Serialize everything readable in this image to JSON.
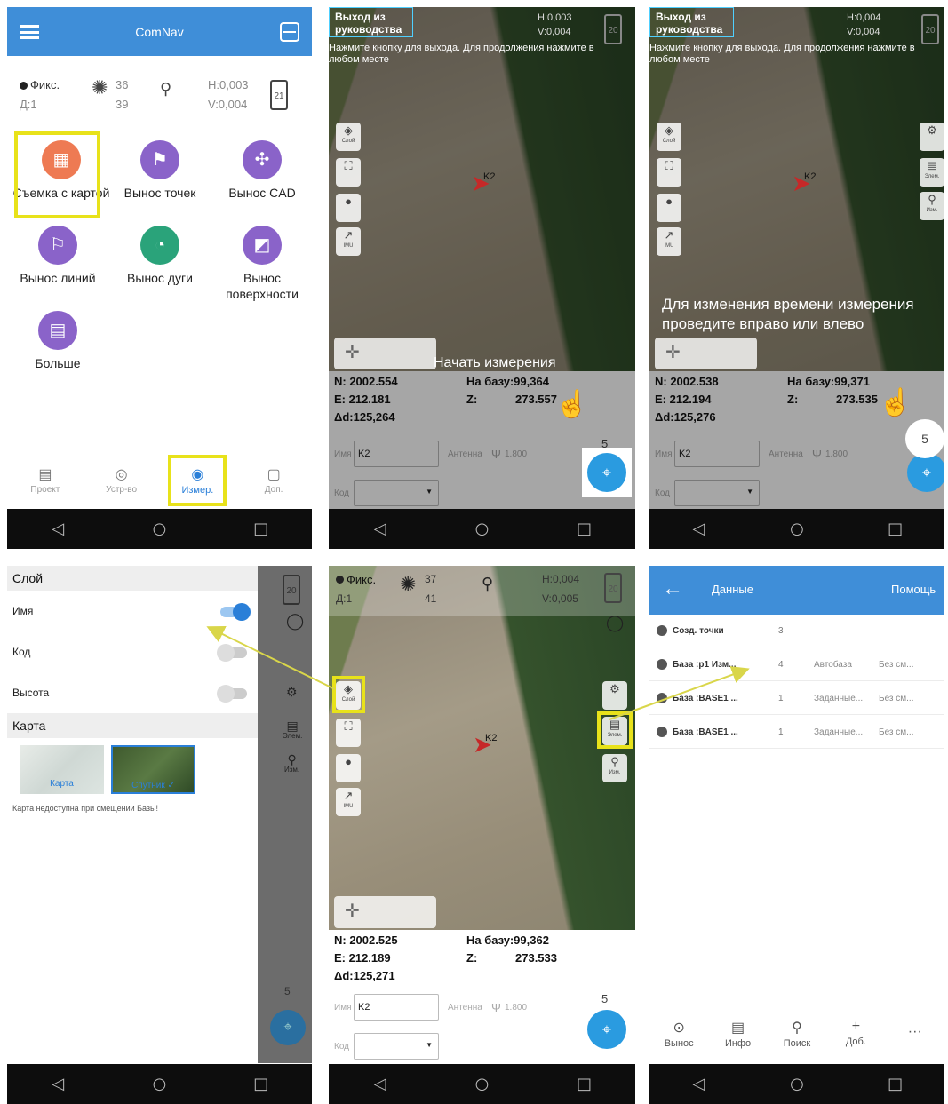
{
  "p1": {
    "app_title": "ComNav",
    "status": {
      "fix": "Фикс.",
      "d": "Д:1",
      "sat1": "36",
      "sat2": "39",
      "h": "H:0,003",
      "v": "V:0,004",
      "battery": "21"
    },
    "tiles": [
      {
        "label": "Съемка с картой",
        "color": "#ee7a53",
        "icon": "map-icon"
      },
      {
        "label": "Вынос точек",
        "color": "#8a63c9",
        "icon": "point-stakeout-icon"
      },
      {
        "label": "Вынос CAD",
        "color": "#8a63c9",
        "icon": "cad-icon"
      },
      {
        "label": "Вынос линий",
        "color": "#8a63c9",
        "icon": "line-stakeout-icon"
      },
      {
        "label": "Вынос дуги",
        "color": "#2aa37a",
        "icon": "arc-icon"
      },
      {
        "label": "Вынос поверхности",
        "color": "#8a63c9",
        "icon": "surface-icon"
      },
      {
        "label": "Больше",
        "color": "#8a63c9",
        "icon": "more-icon"
      }
    ],
    "tabs": [
      {
        "label": "Проект",
        "icon": "project-icon"
      },
      {
        "label": "Устр-во",
        "icon": "device-icon"
      },
      {
        "label": "Измер.",
        "icon": "measure-icon",
        "active": true
      },
      {
        "label": "Доп.",
        "icon": "extra-icon"
      }
    ]
  },
  "p2": {
    "guide_title": "Выход из руководства",
    "guide_hint": "Нажмите кнопку для выхода. Для продолжения нажмите в любом месте",
    "status_h": "H:0,003",
    "status_v": "V:0,004",
    "battery": "20",
    "big_hint": "Начать измерения",
    "n": "N:  2002.554",
    "e": "E:  212.181",
    "d": "Δd:125,264",
    "base": "На базу:99,364",
    "z_label": "Z:",
    "z": "273.557",
    "name_label": "Имя",
    "name_value": "K2",
    "ant_label": "Антенна",
    "ant_value": "1.800",
    "code_label": "Код",
    "count": "5",
    "side": {
      "layer": "Слой",
      "imu": "IMU"
    },
    "marker_label": "K2"
  },
  "p3": {
    "guide_title": "Выход из руководства",
    "guide_hint": "Нажмите кнопку для выхода. Для продолжения нажмите в любом месте",
    "status_h": "H:0,004",
    "status_v": "V:0,004",
    "battery": "20",
    "big_hint": "Для изменения времени измерения проведите вправо или влево",
    "n": "N:  2002.538",
    "e": "E:  212.194",
    "d": "Δd:125,276",
    "base": "На базу:99,371",
    "z_label": "Z:",
    "z": "273.535",
    "name_label": "Имя",
    "name_value": "K2",
    "ant_label": "Антенна",
    "ant_value": "1.800",
    "code_label": "Код",
    "count": "5",
    "side": {
      "layer": "Слой",
      "imu": "IMU",
      "elem": "Элем.",
      "meas": "Изм."
    },
    "marker_label": "K2"
  },
  "p4": {
    "layer_title": "Слой",
    "rows": [
      {
        "label": "Имя",
        "on": true
      },
      {
        "label": "Код",
        "on": false
      },
      {
        "label": "Высота",
        "on": false
      }
    ],
    "map_title": "Карта",
    "thumb_a": "Карта",
    "thumb_b": "Спутник",
    "note": "Карта недоступна при смещении Базы!",
    "battery": "20",
    "side": {
      "elem": "Элем.",
      "meas": "Изм."
    },
    "count": "5"
  },
  "p5": {
    "status": {
      "fix": "Фикс.",
      "d": "Д:1",
      "sat1": "37",
      "sat2": "41",
      "h": "H:0,004",
      "v": "V:0,005",
      "battery": "20"
    },
    "side": {
      "layer": "Слой",
      "imu": "IMU",
      "elem": "Элем.",
      "meas": "Изм."
    },
    "marker_label": "K2",
    "n": "N:  2002.525",
    "e": "E:  212.189",
    "d": "Δd:125,271",
    "base": "На базу:99,362",
    "z_label": "Z:",
    "z": "273.533",
    "name_label": "Имя",
    "name_value": "K2",
    "ant_label": "Антенна",
    "ant_value": "1.800",
    "code_label": "Код",
    "count": "5"
  },
  "p6": {
    "title": "Данные",
    "help": "Помощь",
    "rows": [
      {
        "name": "Созд. точки",
        "num": "3",
        "type": "",
        "shift": ""
      },
      {
        "name": "База :p1 Изм...",
        "num": "4",
        "type": "Автобаза",
        "shift": "Без см..."
      },
      {
        "name": "База :BASE1 ...",
        "num": "1",
        "type": "Заданные...",
        "shift": "Без см..."
      },
      {
        "name": "База :BASE1 ...",
        "num": "1",
        "type": "Заданные...",
        "shift": "Без см..."
      }
    ],
    "tabs": [
      {
        "label": "Вынос",
        "icon": "stakeout-icon"
      },
      {
        "label": "Инфо",
        "icon": "info-icon"
      },
      {
        "label": "Поиск",
        "icon": "search-icon"
      },
      {
        "label": "Доб.",
        "icon": "add-icon"
      },
      {
        "label": "",
        "icon": "more-icon"
      }
    ]
  },
  "highlight_color": "#e8e21a"
}
